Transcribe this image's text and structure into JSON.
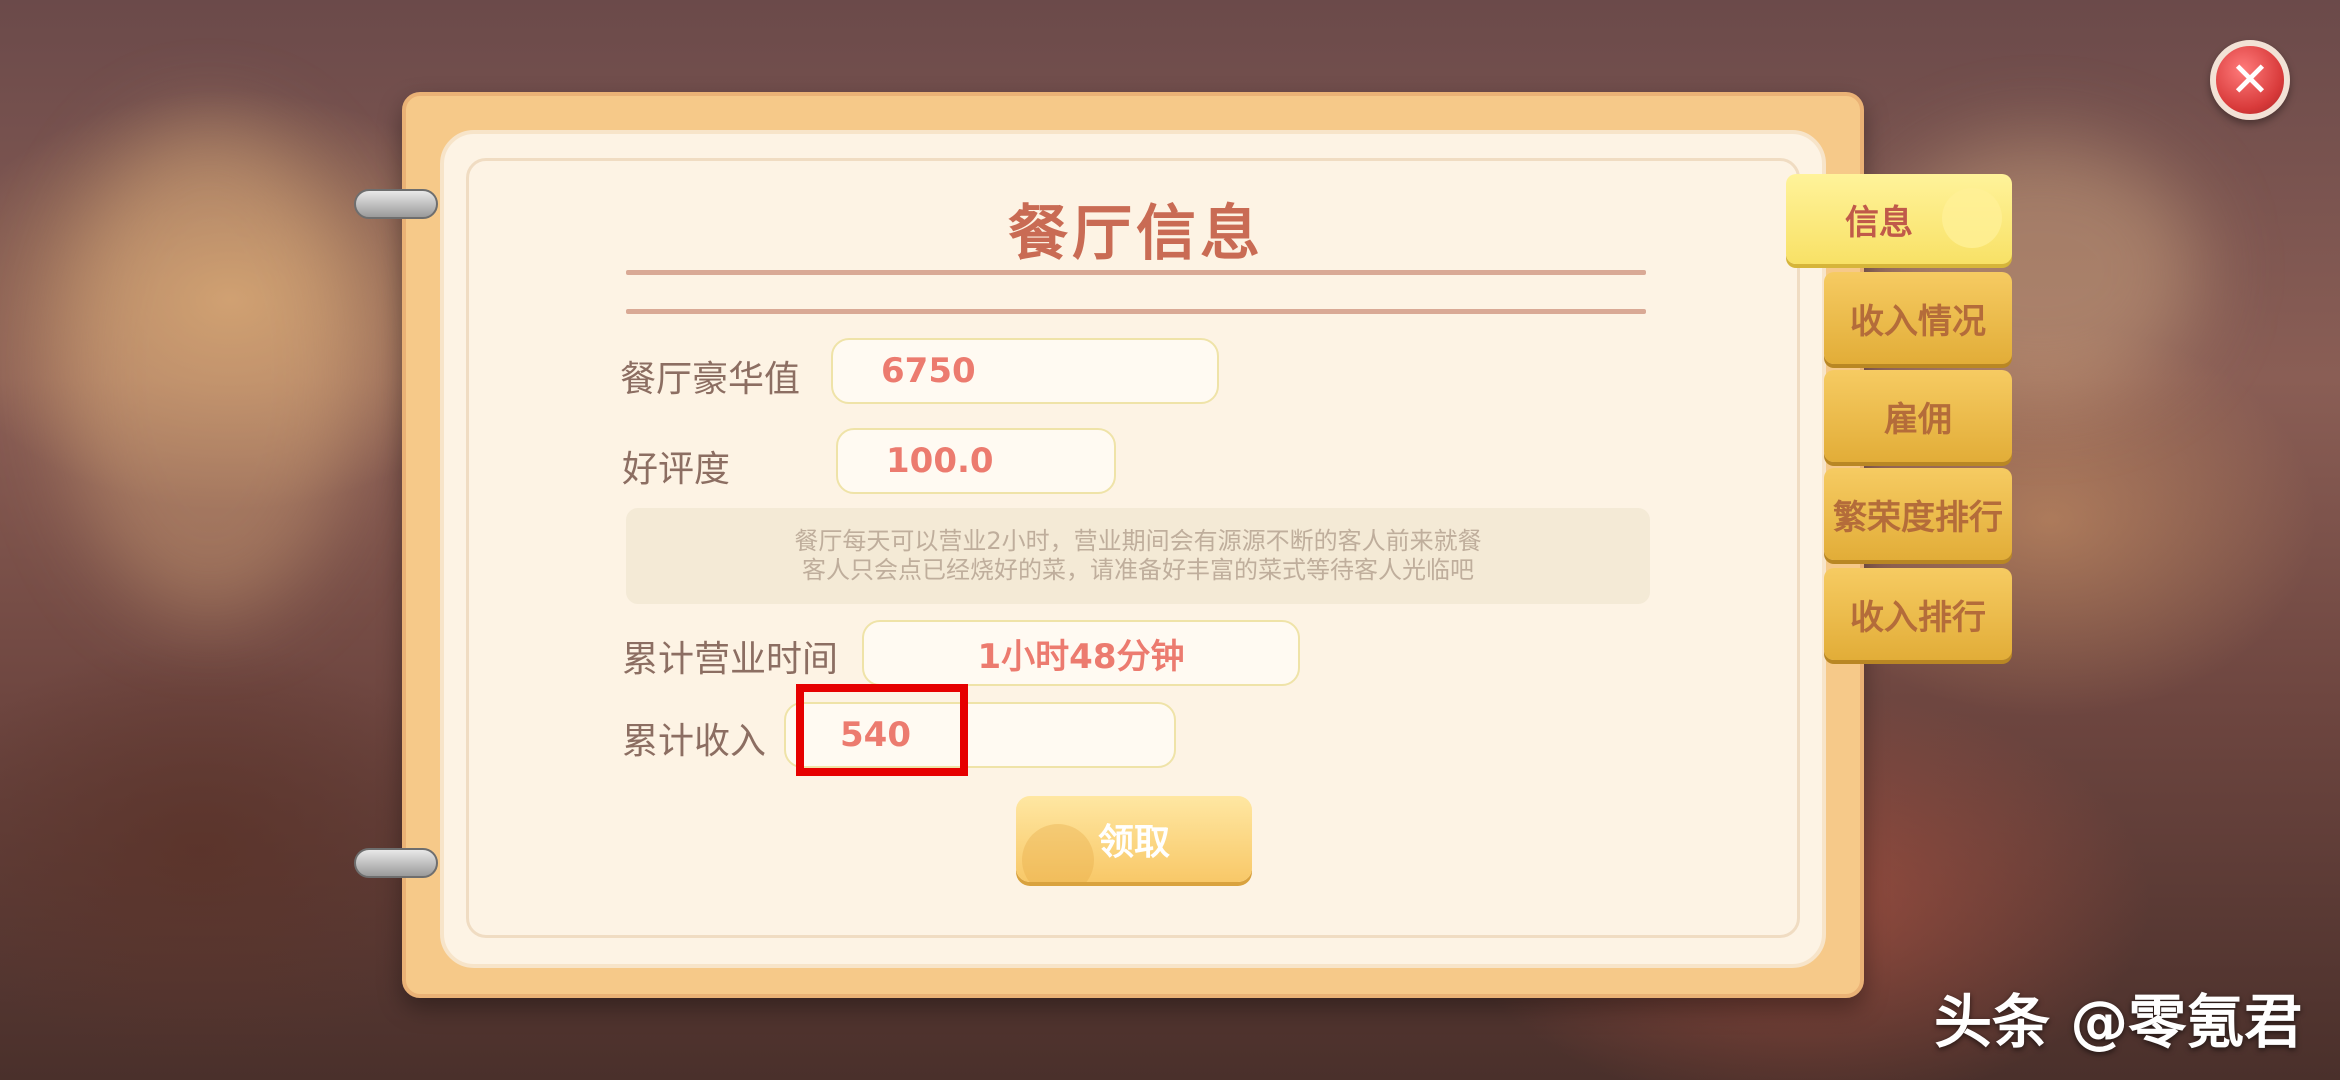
{
  "dialog": {
    "title": "餐厅信息",
    "fields": {
      "luxury_label": "餐厅豪华值",
      "luxury_value": "6750",
      "rating_label": "好评度",
      "rating_value": "100.0",
      "note_line1": "餐厅每天可以营业2小时，营业期间会有源源不断的客人前来就餐",
      "note_line2": "客人只会点已经烧好的菜，请准备好丰富的菜式等待客人光临吧",
      "hours_label": "累计营业时间",
      "hours_value": "1小时48分钟",
      "income_label": "累计收入",
      "income_value": "540"
    },
    "claim_button": "领取"
  },
  "tabs": [
    {
      "label": "信息",
      "active": true
    },
    {
      "label": "收入情况",
      "active": false
    },
    {
      "label": "雇佣",
      "active": false
    },
    {
      "label": "繁荣度排行",
      "active": false
    },
    {
      "label": "收入排行",
      "active": false
    }
  ],
  "watermark": "头条 @零氪君",
  "colors": {
    "accent_red": "#e60000",
    "value_text": "#ec7b6f",
    "title_text": "#c96b54",
    "tab_gold": "#f6cb62"
  },
  "icons": {
    "close": "close-icon"
  }
}
